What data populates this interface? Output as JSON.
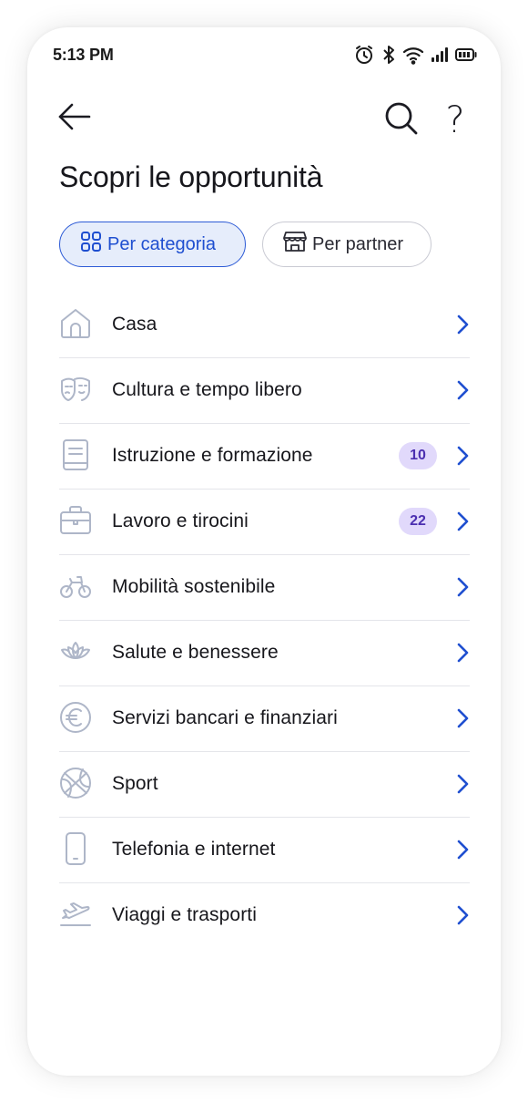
{
  "status_bar": {
    "time": "5:13 PM",
    "icons": [
      "alarm-icon",
      "bluetooth-icon",
      "wifi-icon",
      "signal-icon",
      "battery-icon"
    ]
  },
  "header": {
    "back_icon": "arrow-left-icon",
    "search_icon": "search-icon",
    "help_label": "?",
    "title": "Scopri le opportunità"
  },
  "tabs": [
    {
      "label": "Per categoria",
      "icon": "grid-icon",
      "active": true
    },
    {
      "label": "Per partner",
      "icon": "store-icon",
      "active": false
    }
  ],
  "categories": [
    {
      "label": "Casa",
      "icon": "house-icon",
      "badge": null
    },
    {
      "label": "Cultura e tempo libero",
      "icon": "theater-masks-icon",
      "badge": null
    },
    {
      "label": "Istruzione e formazione",
      "icon": "book-icon",
      "badge": "10"
    },
    {
      "label": "Lavoro e tirocini",
      "icon": "briefcase-icon",
      "badge": "22"
    },
    {
      "label": "Mobilità sostenibile",
      "icon": "bicycle-icon",
      "badge": null
    },
    {
      "label": "Salute e benessere",
      "icon": "lotus-icon",
      "badge": null
    },
    {
      "label": "Servizi bancari e finanziari",
      "icon": "euro-icon",
      "badge": null
    },
    {
      "label": "Sport",
      "icon": "basketball-icon",
      "badge": null
    },
    {
      "label": "Telefonia e internet",
      "icon": "smartphone-icon",
      "badge": null
    },
    {
      "label": "Viaggi e trasporti",
      "icon": "plane-icon",
      "badge": null
    }
  ],
  "colors": {
    "accent": "#2d5bd6",
    "chevron": "#1f4fd0",
    "badge_bg": "#e1d9fb",
    "badge_text": "#4b2fb0",
    "icon_muted": "#aeb6c8"
  }
}
